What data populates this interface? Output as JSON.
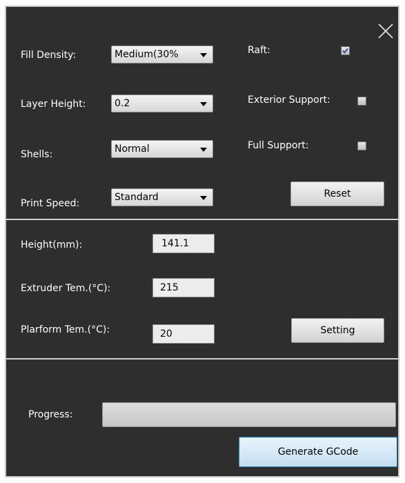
{
  "settings": {
    "fill_density": {
      "label": "Fill Density:",
      "value": "Medium(30%"
    },
    "layer_height": {
      "label": "Layer Height:",
      "value": "0.2"
    },
    "shells": {
      "label": "Shells:",
      "value": "Normal"
    },
    "print_speed": {
      "label": "Print Speed:",
      "value": "Standard"
    },
    "raft": {
      "label": "Raft:",
      "checked": true
    },
    "exterior_support": {
      "label": "Exterior Support:",
      "checked": false
    },
    "full_support": {
      "label": "Full Support:",
      "checked": false
    },
    "reset_label": "Reset"
  },
  "info": {
    "height": {
      "label": "Height(mm):",
      "value": "141.1"
    },
    "extruder_temp": {
      "label": "Extruder Tem.(°C):",
      "value": "215"
    },
    "platform_temp": {
      "label": "Plarform Tem.(°C):",
      "value": "20"
    },
    "setting_label": "Setting"
  },
  "footer": {
    "progress_label": "Progress:",
    "progress_fraction": 0,
    "generate_label": "Generate GCode"
  },
  "colors": {
    "panel_bg": "#2e2e2e",
    "text": "#ffffff",
    "generate_border": "#3c7fb1"
  },
  "icons": {
    "close": "close-icon",
    "check": "check-icon",
    "dropdown": "chevron-down-icon"
  }
}
